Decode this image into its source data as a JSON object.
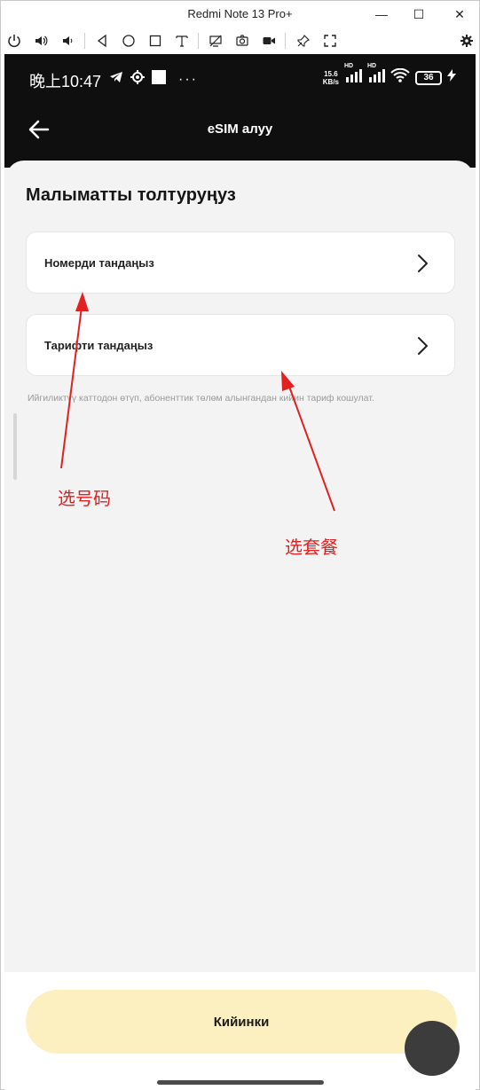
{
  "window": {
    "title": "Redmi Note 13 Pro+"
  },
  "toolbar": {
    "icons": [
      "power-icon",
      "volume-up-icon",
      "volume-down-icon",
      "back-triangle-icon",
      "home-circle-icon",
      "recent-square-icon",
      "text-input-icon",
      "screen-off-icon",
      "screenshot-icon",
      "record-icon",
      "pin-icon",
      "fullscreen-icon",
      "settings-gear-icon"
    ]
  },
  "status": {
    "time": "晚上10:47",
    "speed_value": "15.6",
    "speed_unit": "KB/s",
    "hd1": "HD",
    "hd2": "HD",
    "battery": "36"
  },
  "header": {
    "title": "eSIM алуу"
  },
  "form": {
    "title": "Малыматты толтуруңуз",
    "number_label": "Номерди тандаңыз",
    "tariff_label": "Тарифти тандаңыз",
    "hint": "Ийгиликтүү каттодон өтүп, абоненттик төлөм алынгандан кийин тариф кошулат."
  },
  "annotations": {
    "select_number": "选号码",
    "select_plan": "选套餐"
  },
  "footer": {
    "next_label": "Кийинки"
  },
  "colors": {
    "accent_button": "#fdf0c0",
    "header_bg": "#0f0f0f",
    "annotation": "#e32020"
  }
}
